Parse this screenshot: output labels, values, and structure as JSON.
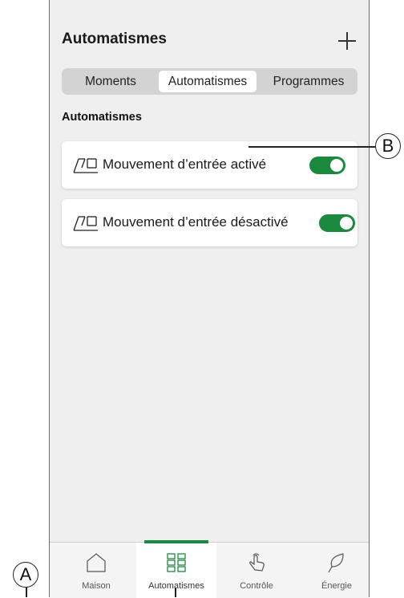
{
  "header": {
    "title": "Automatismes",
    "add_icon": "plus-icon"
  },
  "tabs": [
    {
      "label": "Moments",
      "active": false
    },
    {
      "label": "Automatismes",
      "active": true
    },
    {
      "label": "Programmes",
      "active": false
    }
  ],
  "section": {
    "label": "Automatismes"
  },
  "automations": [
    {
      "icon": "garage-door-icon",
      "label": "Mouvement d’entrée activé",
      "enabled": true
    },
    {
      "icon": "garage-door-icon",
      "label": "Mouvement d’entrée désactivé",
      "enabled": true
    }
  ],
  "bottom_nav": [
    {
      "icon": "home-icon",
      "label": "Maison",
      "active": false
    },
    {
      "icon": "grid-icon",
      "label": "Automatismes",
      "active": true
    },
    {
      "icon": "touch-icon",
      "label": "Contrôle",
      "active": false
    },
    {
      "icon": "leaf-icon",
      "label": "Énergie",
      "active": false
    }
  ],
  "callouts": {
    "a": "A",
    "b": "B"
  },
  "colors": {
    "accent": "#1c8a3e",
    "background": "#efefef"
  }
}
